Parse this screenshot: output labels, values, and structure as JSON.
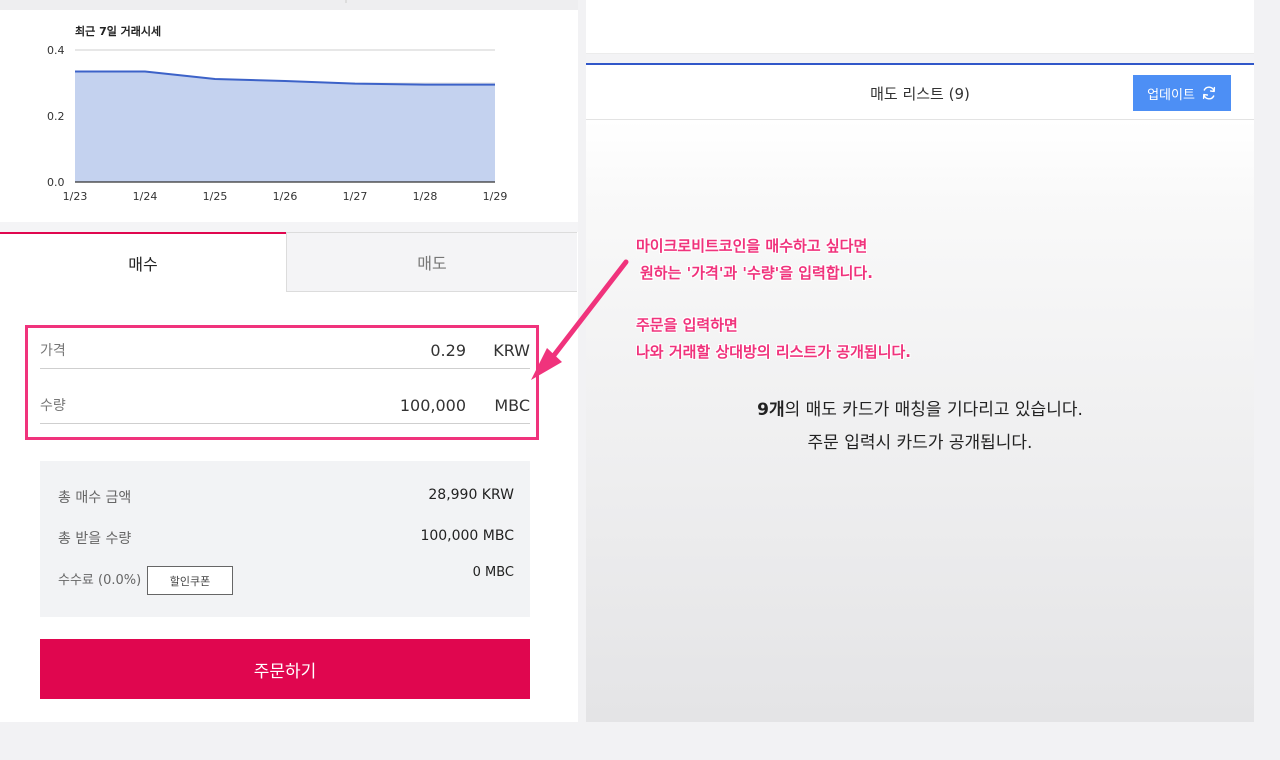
{
  "chart_data": {
    "type": "area",
    "title": "최근 7일 거래시세",
    "xlabel": "",
    "ylabel": "",
    "x": [
      "1/23",
      "1/24",
      "1/25",
      "1/26",
      "1/27",
      "1/28",
      "1/29"
    ],
    "series": [
      {
        "values": [
          0.335,
          0.335,
          0.312,
          0.306,
          0.298,
          0.295,
          0.295
        ]
      }
    ],
    "ylim": [
      0,
      0.4
    ],
    "yticks": [
      "0.0",
      "0.2",
      "0.4"
    ],
    "grid": true,
    "colors": {
      "line": "#3c62c8",
      "fill": "#c4d2ef"
    }
  },
  "tabs": {
    "buy": "매수",
    "sell": "매도"
  },
  "order_form": {
    "price_label": "가격",
    "price_value": "0.29",
    "price_unit": "KRW",
    "qty_label": "수량",
    "qty_value": "100,000",
    "qty_unit": "MBC"
  },
  "summary": {
    "total_label": "총 매수 금액",
    "total_value": "28,990 KRW",
    "receive_label": "총 받을 수량",
    "receive_value": "100,000 MBC",
    "fee_label": "수수료 (0.0%)",
    "coupon_button": "할인쿠폰",
    "fee_value": "0 MBC"
  },
  "order_button": "주문하기",
  "sell_list": {
    "title": "매도 리스트 (9)",
    "update_button": "업데이트",
    "waiting_count": "9개",
    "waiting_line1_rest": "의 매도 카드가 매칭을 기다리고 있습니다.",
    "waiting_line2": "주문 입력시 카드가 공개됩니다."
  },
  "annotation": {
    "line1": "마이크로비트코인을 매수하고 싶다면",
    "line2": "원하는 '가격'과 '수량'을 입력합니다.",
    "line3": "주문을 입력하면",
    "line4": "나와 거래할 상대방의 리스트가 공개됩니다."
  },
  "colors": {
    "accent": "#e0064f",
    "highlight": "#f0337c",
    "update_button": "#4d8ff5",
    "divider": "#3157c9"
  }
}
